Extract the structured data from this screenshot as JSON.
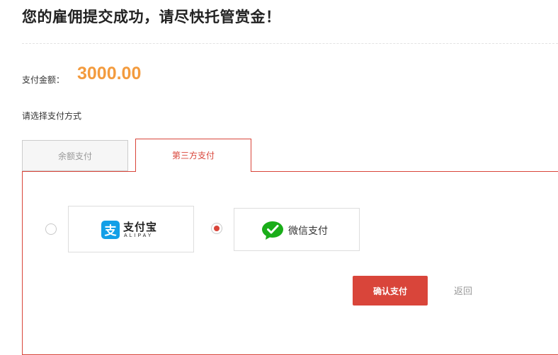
{
  "header": {
    "title": "您的雇佣提交成功，请尽快托管赏金！"
  },
  "payment": {
    "amount_label": "支付金额：",
    "amount_value": "3000.00",
    "method_prompt": "请选择支付方式"
  },
  "tabs": [
    {
      "label": "余额支付",
      "active": false
    },
    {
      "label": "第三方支付",
      "active": true
    }
  ],
  "methods": {
    "alipay": {
      "name": "支付宝",
      "subtitle": "ALIPAY",
      "logo_glyph": "支",
      "icon": "alipay-icon",
      "selected": false
    },
    "wechat": {
      "name": "微信支付",
      "icon": "wechat-icon",
      "selected": true
    }
  },
  "actions": {
    "confirm_label": "确认支付",
    "back_label": "返回"
  },
  "colors": {
    "accent": "#d9453a",
    "amount": "#f39b3e",
    "alipay_blue": "#129fe7",
    "wechat_green": "#1aad19"
  }
}
